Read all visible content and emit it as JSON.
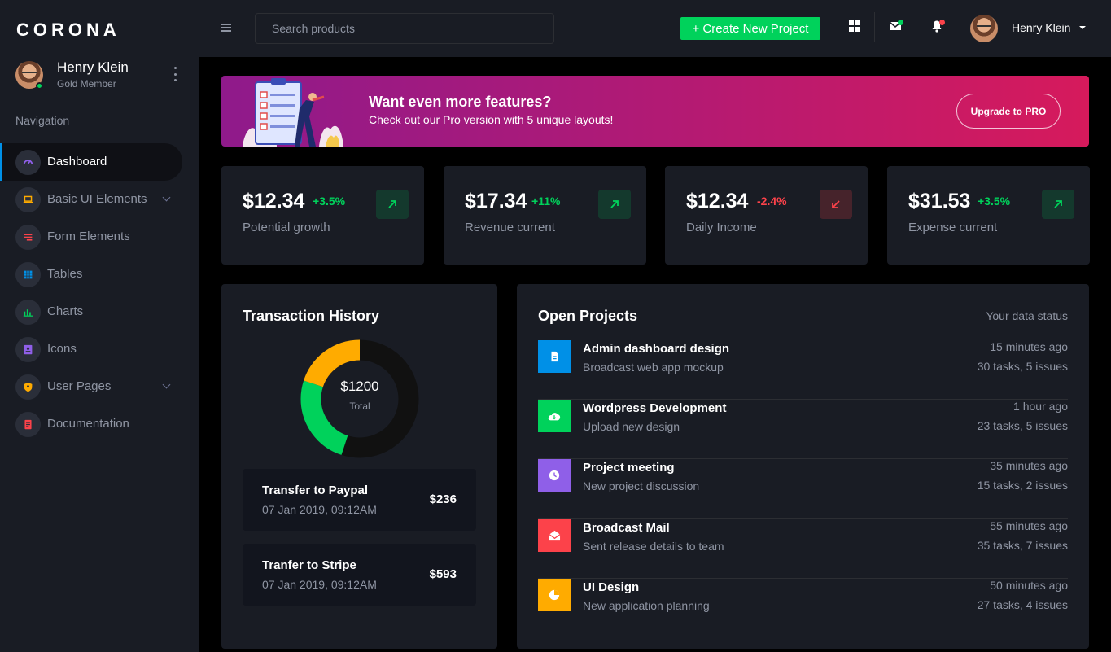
{
  "sidebar": {
    "brand": "CORONA",
    "profile": {
      "name": "Henry Klein",
      "role": "Gold Member"
    },
    "nav_heading": "Navigation",
    "items": [
      {
        "label": "Dashboard",
        "icon": "speedometer-icon",
        "color": "#8f5fe8",
        "active": true
      },
      {
        "label": "Basic UI Elements",
        "icon": "laptop-icon",
        "color": "#ffab00",
        "expandable": true
      },
      {
        "label": "Form Elements",
        "icon": "form-list-icon",
        "color": "#fc424a"
      },
      {
        "label": "Tables",
        "icon": "table-icon",
        "color": "#0090e7"
      },
      {
        "label": "Charts",
        "icon": "bar-chart-icon",
        "color": "#00d25b"
      },
      {
        "label": "Icons",
        "icon": "contacts-icon",
        "color": "#8f5fe8"
      },
      {
        "label": "User Pages",
        "icon": "shield-icon",
        "color": "#ffab00",
        "expandable": true
      },
      {
        "label": "Documentation",
        "icon": "file-document-icon",
        "color": "#fc424a"
      }
    ]
  },
  "topbar": {
    "search_placeholder": "Search products",
    "create_label": "+ Create New Project",
    "user_name": "Henry Klein",
    "icons": [
      "grid-icon",
      "mail-icon",
      "bell-icon"
    ]
  },
  "banner": {
    "title": "Want even more features?",
    "subtitle": "Check out our Pro version with 5 unique layouts!",
    "button": "Upgrade to PRO"
  },
  "stats": [
    {
      "value": "$12.34",
      "delta": "+3.5%",
      "label": "Potential growth",
      "trend": "up"
    },
    {
      "value": "$17.34",
      "delta": "+11%",
      "label": "Revenue current",
      "trend": "up"
    },
    {
      "value": "$12.34",
      "delta": "-2.4%",
      "label": "Daily Income",
      "trend": "down"
    },
    {
      "value": "$31.53",
      "delta": "+3.5%",
      "label": "Expense current",
      "trend": "up"
    }
  ],
  "transactions": {
    "title": "Transaction History",
    "donut": {
      "amount": "$1200",
      "label": "Total",
      "segments": [
        {
          "value": 55,
          "color": "#111111"
        },
        {
          "value": 25,
          "color": "#00d25b"
        },
        {
          "value": 20,
          "color": "#ffab00"
        }
      ]
    },
    "items": [
      {
        "name": "Transfer to Paypal",
        "date": "07 Jan 2019, 09:12AM",
        "amount": "$236"
      },
      {
        "name": "Tranfer to Stripe",
        "date": "07 Jan 2019, 09:12AM",
        "amount": "$593"
      }
    ]
  },
  "projects": {
    "title": "Open Projects",
    "status": "Your data status",
    "items": [
      {
        "title": "Admin dashboard design",
        "subtitle": "Broadcast web app mockup",
        "time": "15 minutes ago",
        "tasks": "30 tasks, 5 issues",
        "icon": "file-icon",
        "color": "#0090e7"
      },
      {
        "title": "Wordpress Development",
        "subtitle": "Upload new design",
        "time": "1 hour ago",
        "tasks": "23 tasks, 5 issues",
        "icon": "cloud-download-icon",
        "color": "#00d25b"
      },
      {
        "title": "Project meeting",
        "subtitle": "New project discussion",
        "time": "35 minutes ago",
        "tasks": "15 tasks, 2 issues",
        "icon": "clock-icon",
        "color": "#8f5fe8"
      },
      {
        "title": "Broadcast Mail",
        "subtitle": "Sent release details to team",
        "time": "55 minutes ago",
        "tasks": "35 tasks, 7 issues",
        "icon": "email-open-icon",
        "color": "#fc424a"
      },
      {
        "title": "UI Design",
        "subtitle": "New application planning",
        "time": "50 minutes ago",
        "tasks": "27 tasks, 4 issues",
        "icon": "pie-chart-icon",
        "color": "#ffab00"
      }
    ]
  }
}
